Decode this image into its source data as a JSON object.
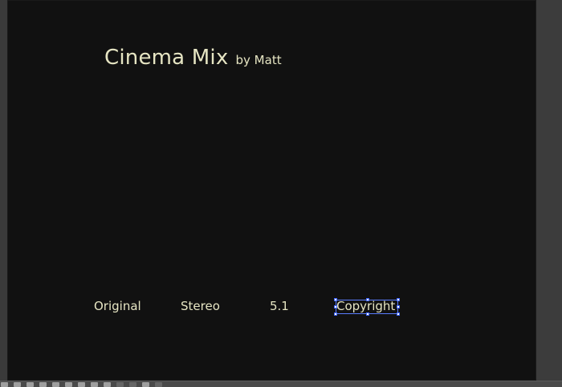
{
  "colors": {
    "canvas_background": "#111111",
    "workspace": "#2a2a2a",
    "menu_text": "#e6e5c3",
    "selection_outline": "#5a7dff"
  },
  "menu": {
    "title": "Cinema Mix",
    "subtitle": "by Matt",
    "buttons": [
      {
        "label": "Original"
      },
      {
        "label": "Stereo"
      },
      {
        "label": "5.1"
      },
      {
        "label": "Copyright",
        "selected": true
      }
    ]
  },
  "toolbar": {
    "icons": [
      "play-icon",
      "stop-icon",
      "grid-icon",
      "settings-icon",
      "layer-icon",
      "monitor-icon",
      "split-icon",
      "record-icon",
      "loop-icon",
      "lock-icon",
      "back-icon",
      "zoom-icon",
      "forward-icon"
    ]
  }
}
